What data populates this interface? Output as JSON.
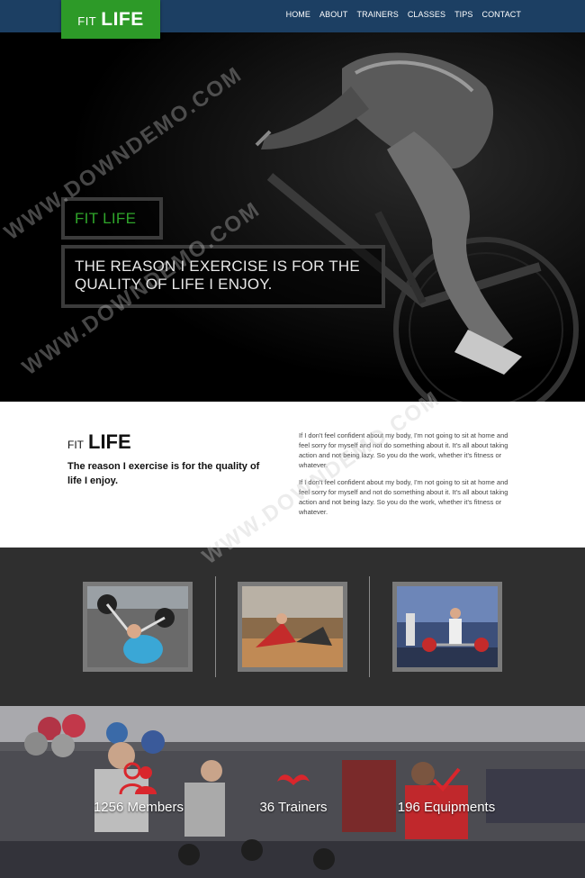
{
  "nav": {
    "logo_prefix": "FIT",
    "logo_main": "LIFE",
    "menu": [
      "HOME",
      "ABOUT",
      "TRAINERS",
      "CLASSES",
      "TIPS",
      "CONTACT"
    ]
  },
  "hero": {
    "tag": "FIT LIFE",
    "quote": "THE REASON I EXERCISE IS FOR THE QUALITY OF LIFE I ENJOY."
  },
  "about": {
    "logo_prefix": "FIT",
    "logo_main": "LIFE",
    "lead": "The reason I exercise is for the quality of life I enjoy.",
    "paragraphs": [
      "If I don't feel confident about my body, I'm not going to sit at home and feel sorry for myself and not do something about it. It's all about taking action and not being lazy. So you do the work, whether it's fitness or whatever.",
      "If I don't feel confident about my body, I'm not going to sit at home and feel sorry for myself and not do something about it. It's all about taking action and not being lazy. So you do the work, whether it's fitness or whatever."
    ]
  },
  "stats": [
    {
      "icon": "members-icon",
      "label": "1256 Members"
    },
    {
      "icon": "trainers-icon",
      "label": "36 Trainers"
    },
    {
      "icon": "equipments-icon",
      "label": "196 Equipments"
    }
  ],
  "watermark": "WWW.DOWNDEMO.COM",
  "colors": {
    "nav": "#1c3f63",
    "brand_green": "#2d9a28",
    "icon_red": "#d9262c",
    "gallery_bg": "#2f2f2f"
  }
}
